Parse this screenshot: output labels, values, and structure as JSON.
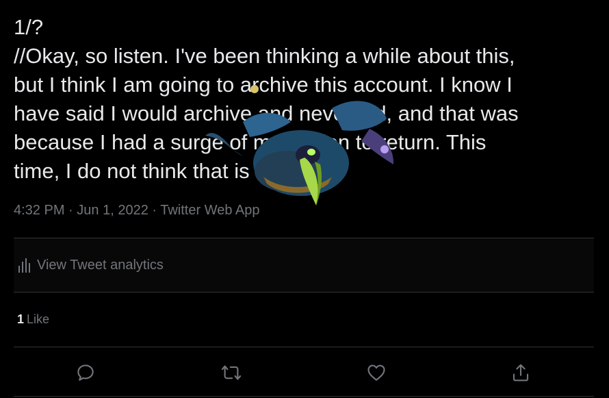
{
  "tweet": {
    "text_lines": [
      "1/?",
      "//Okay, so listen. I've been thinking a while about this,",
      "but I think I am going to archive this account. I know I",
      "have said I would archive and never did, and that was",
      "because I had a surge of motivation to return. This",
      "time, I do not think that is the case."
    ],
    "time": "4:32 PM",
    "separator": "·",
    "date": "Jun 1, 2022",
    "source": "Twitter Web App"
  },
  "analytics": {
    "label": "View Tweet analytics",
    "icon": "bar-chart-icon"
  },
  "likes": {
    "count": "1",
    "label": "Like"
  },
  "actions": [
    {
      "name": "reply",
      "icon": "reply-icon"
    },
    {
      "name": "retweet",
      "icon": "retweet-icon"
    },
    {
      "name": "like",
      "icon": "heart-icon"
    },
    {
      "name": "share",
      "icon": "share-icon"
    }
  ],
  "colors": {
    "background": "#000000",
    "text_primary": "#e7e9ea",
    "text_secondary": "#71767b",
    "border": "#2f3336",
    "icon": "#71767b"
  }
}
